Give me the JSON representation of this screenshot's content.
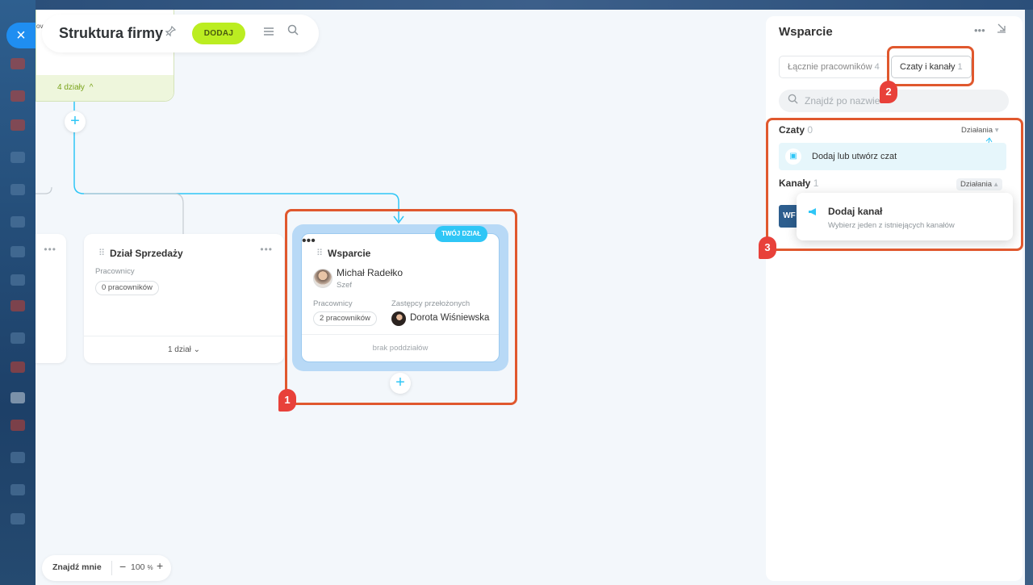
{
  "header": {
    "title": "Struktura firmy",
    "add_label": "DODAJ",
    "close_glyph": "×",
    "top_fragment": "ov"
  },
  "top_card": {
    "footer_label": "4 działy",
    "chevron": "^"
  },
  "departments": [
    {
      "title": "Dział Sprzedaży",
      "employees_label": "Pracownicy",
      "employees_chip": "0 pracowników",
      "footer": "1 dział",
      "footer_chevron": "⌄"
    },
    {
      "title": "Wsparcie",
      "badge": "TWÓJ DZIAŁ",
      "head_name": "Michał Radełko",
      "head_role": "Szef",
      "employees_label": "Pracownicy",
      "employees_chip": "2 pracowników",
      "deputies_label": "Zastępcy przełożonych",
      "deputy_name": "Dorota Wiśniewska",
      "footer": "brak poddziałów"
    }
  ],
  "annotations": [
    "1",
    "2",
    "3"
  ],
  "zoom": {
    "find_me": "Znajdź mnie",
    "minus": "−",
    "value": "100",
    "unit": "%",
    "plus": "+"
  },
  "panel": {
    "title": "Wsparcie",
    "tabs": [
      {
        "label": "Łącznie pracowników",
        "count": "4",
        "active": false
      },
      {
        "label": "Czaty i kanały",
        "count": "1",
        "active": true
      }
    ],
    "search_placeholder": "Znajdź po nazwie",
    "chats": {
      "title": "Czaty",
      "count": "0",
      "actions": "Działania",
      "add_row": "Dodaj lub utwórz czat"
    },
    "channels": {
      "title": "Kanały",
      "count": "1",
      "actions": "Działania",
      "thumb_text": "WF"
    },
    "dropdown": {
      "title": "Dodaj kanał",
      "subtitle": "Wybierz jeden z istniejących kanałów"
    }
  },
  "colors": {
    "accent": "#2fc6f6",
    "add_button": "#bbed21",
    "annotation": "#e0582e",
    "selection": "#b8d9f6"
  },
  "icons": [
    "close-icon",
    "pin-icon",
    "menu-icon",
    "search-icon",
    "drag-handle-icon",
    "more-icon",
    "plus-icon",
    "chevron-down-icon",
    "collapse-icon",
    "chat-icon",
    "megaphone-icon"
  ]
}
